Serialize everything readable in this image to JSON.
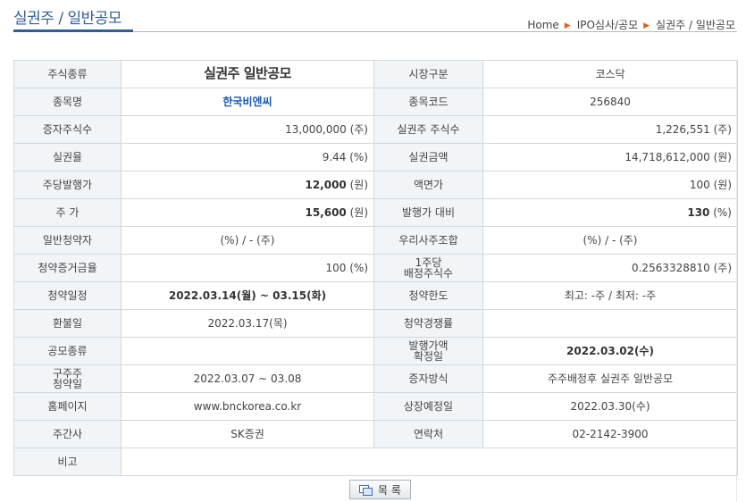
{
  "page": {
    "title": "실권주 / 일반공모",
    "breadcrumb": [
      "Home",
      "IPO심사/공모",
      "실권주 / 일반공모"
    ],
    "breadcrumb_sep": "▶"
  },
  "info": {
    "stock_type_label": "주식종류",
    "stock_type_value": "실권주 일반공모",
    "market_label": "시장구분",
    "market_value": "코스닥",
    "name_label": "종목명",
    "name_value": "한국비엔씨",
    "code_label": "종목코드",
    "code_value": "256840",
    "capital_shares_label": "증자주식수",
    "capital_shares_value": "13,000,000 (주)",
    "forfeited_shares_label": "실권주 주식수",
    "forfeited_shares_value": "1,226,551 (주)",
    "forfeit_rate_label": "실권율",
    "forfeit_rate_value": "9.44 (%)",
    "forfeit_amount_label": "실권금액",
    "forfeit_amount_value": "14,718,612,000 (원)",
    "issue_price_label": "주당발행가",
    "issue_price_num": "12,000",
    "issue_price_unit": " (원)",
    "par_label": "액면가",
    "par_value": "100 (원)",
    "price_label": "주 가",
    "price_num": "15,600",
    "price_unit": " (원)",
    "vs_issue_label": "발행가 대비",
    "vs_issue_num": "130",
    "vs_issue_unit": " (%)",
    "general_sub_label": "일반청약자",
    "general_sub_value": "(%)  / - (주)",
    "employee_label": "우리사주조합",
    "employee_value": "(%)  / - (주)",
    "margin_label": "청약증거금율",
    "margin_value": "100 (%)",
    "per_share_label_1": "1주당",
    "per_share_label_2": "배정주식수",
    "per_share_value": "0.2563328810 (주)",
    "sub_date_label": "청약일정",
    "sub_date_value": "2022.03.14(월) ~ 03.15(화)",
    "sub_limit_label": "청약한도",
    "sub_limit_value": "최고: -주  /  최저: -주",
    "refund_label": "환불일",
    "refund_value": "2022.03.17(목)",
    "competition_label": "청약경쟁률",
    "competition_value": "",
    "offer_type_label": "공모종류",
    "offer_type_value": "",
    "price_fix_label_1": "발행가액",
    "price_fix_label_2": "확정일",
    "price_fix_value": "2022.03.02(수)",
    "old_sub_label_1": "구주주",
    "old_sub_label_2": "청약일",
    "old_sub_value": "2022.03.07 ~ 03.08",
    "method_label": "증자방식",
    "method_value": "주주배정후 실권주 일반공모",
    "homepage_label": "홈페이지",
    "homepage_value": "www.bnckorea.co.kr",
    "listing_label": "상장예정일",
    "listing_value": "2022.03.30(수)",
    "manager_label": "주간사",
    "manager_value": "SK증권",
    "contact_label": "연락처",
    "contact_value": "02-2142-3900",
    "remarks_label": "비고",
    "remarks_value": ""
  },
  "footer": {
    "list_button_label": "목 록",
    "list_icon": "list-icon"
  },
  "colors": {
    "title": "#2f5f9a",
    "link": "#1a55b5",
    "label_bg": "#f2f5f8",
    "border": "#cfd8df",
    "breadcrumb_sep": "#e0602a"
  }
}
